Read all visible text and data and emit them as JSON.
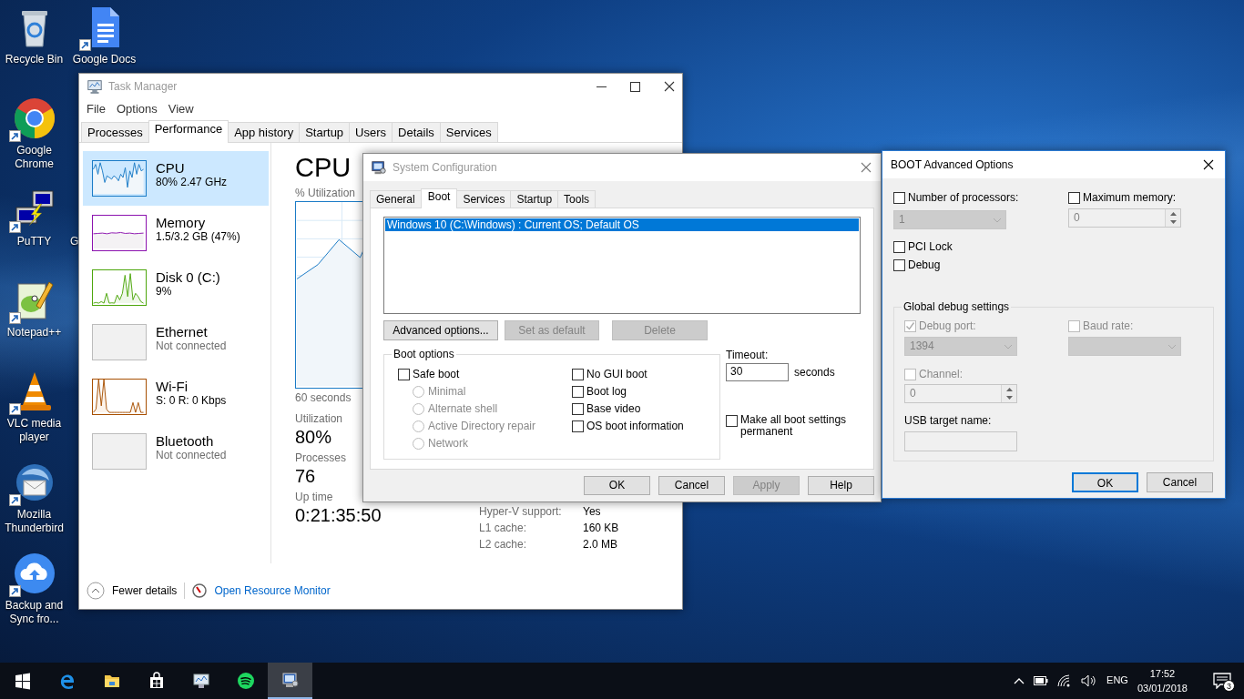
{
  "desktop_icons": [
    {
      "kind": "recycle",
      "label": "Recycle Bin",
      "shortcut": false
    },
    {
      "kind": "chrome",
      "label": "Google Chrome",
      "shortcut": true
    },
    {
      "kind": "putty",
      "label": "PuTTY",
      "shortcut": true
    },
    {
      "kind": "notepad",
      "label": "Notepad++",
      "shortcut": true
    },
    {
      "kind": "vlc",
      "label": "VLC media player",
      "shortcut": true
    },
    {
      "kind": "thunderbird",
      "label": "Mozilla Thunderbird",
      "shortcut": true
    },
    {
      "kind": "backup",
      "label": "Backup and Sync fro...",
      "shortcut": true
    }
  ],
  "desktop_icons_column_2": [
    {
      "kind": "docs",
      "label": "Google Docs",
      "shortcut": true
    },
    {
      "kind": "covered",
      "label": "G"
    }
  ],
  "task_manager": {
    "title": "Task Manager",
    "menu": [
      "File",
      "Options",
      "View"
    ],
    "tabs": [
      {
        "label": "Processes",
        "selected": false
      },
      {
        "label": "Performance",
        "selected": true
      },
      {
        "label": "App history",
        "selected": false
      },
      {
        "label": "Startup",
        "selected": false
      },
      {
        "label": "Users",
        "selected": false
      },
      {
        "label": "Details",
        "selected": false
      },
      {
        "label": "Services",
        "selected": false
      }
    ],
    "resources": [
      {
        "kind": "cpu",
        "name": "CPU",
        "detail": "80% 2.47 GHz",
        "connected": true,
        "selected": true,
        "color": "#1b7bc6"
      },
      {
        "kind": "memory",
        "name": "Memory",
        "detail": "1.5/3.2 GB (47%)",
        "connected": true,
        "selected": false,
        "color": "#8b12ae"
      },
      {
        "kind": "disk",
        "name": "Disk 0 (C:)",
        "detail": "9%",
        "connected": true,
        "selected": false,
        "color": "#4da60c"
      },
      {
        "kind": "idle",
        "name": "Ethernet",
        "detail": "Not connected",
        "connected": false,
        "selected": false
      },
      {
        "kind": "wifi",
        "name": "Wi-Fi",
        "detail": "S: 0 R: 0 Kbps",
        "connected": true,
        "selected": false,
        "color": "#a74f01"
      },
      {
        "kind": "idle",
        "name": "Bluetooth",
        "detail": "Not connected",
        "connected": false,
        "selected": false
      }
    ],
    "panel": {
      "title": "CPU",
      "graph_label": "% Utilization",
      "time_span": "60 seconds",
      "stats": [
        {
          "label": "Utilization",
          "value": "80%"
        },
        {
          "label": "Processes",
          "value": "76"
        },
        {
          "label": "Up time",
          "value": "0:21:35:50"
        }
      ],
      "specs": [
        {
          "label": "Hyper-V support:",
          "value": "Yes"
        },
        {
          "label": "L1 cache:",
          "value": "160 KB"
        },
        {
          "label": "L2 cache:",
          "value": "2.0 MB"
        }
      ]
    },
    "footer": {
      "fewer_details": "Fewer details",
      "resource_monitor": "Open Resource Monitor"
    }
  },
  "system_configuration": {
    "title": "System Configuration",
    "tabs": [
      {
        "label": "General",
        "selected": false
      },
      {
        "label": "Boot",
        "selected": true
      },
      {
        "label": "Services",
        "selected": false
      },
      {
        "label": "Startup",
        "selected": false
      },
      {
        "label": "Tools",
        "selected": false
      }
    ],
    "boot_entries": [
      {
        "label": "Windows 10 (C:\\Windows) : Current OS; Default OS",
        "selected": true
      }
    ],
    "entry_buttons": [
      {
        "label": "Advanced options...",
        "disabled": false
      },
      {
        "label": "Set as default",
        "disabled": true
      },
      {
        "label": "Delete",
        "disabled": true
      }
    ],
    "boot_options": {
      "title": "Boot options",
      "safe_boot": {
        "label": "Safe boot",
        "checked": false
      },
      "safe_boot_modes": [
        {
          "label": "Minimal",
          "selected": false,
          "disabled": true
        },
        {
          "label": "Alternate shell",
          "selected": false,
          "disabled": true
        },
        {
          "label": "Active Directory repair",
          "selected": false,
          "disabled": true
        },
        {
          "label": "Network",
          "selected": false,
          "disabled": true
        }
      ],
      "flags": [
        {
          "label": "No GUI boot",
          "checked": false
        },
        {
          "label": "Boot log",
          "checked": false
        },
        {
          "label": "Base video",
          "checked": false
        },
        {
          "label": "OS boot information",
          "checked": false
        }
      ]
    },
    "timeout": {
      "label": "Timeout:",
      "value": "30",
      "unit": "seconds"
    },
    "make_permanent": {
      "label": "Make all boot settings permanent",
      "checked": false
    },
    "buttons": [
      {
        "label": "OK",
        "disabled": false
      },
      {
        "label": "Cancel",
        "disabled": false
      },
      {
        "label": "Apply",
        "disabled": true
      },
      {
        "label": "Help",
        "disabled": false
      }
    ]
  },
  "boot_advanced": {
    "title": "BOOT Advanced Options",
    "number_of_processors": {
      "label": "Number of processors:",
      "checked": false,
      "value": "1"
    },
    "maximum_memory": {
      "label": "Maximum memory:",
      "checked": false,
      "value": "0"
    },
    "pci_lock": {
      "label": "PCI Lock",
      "checked": false
    },
    "debug": {
      "label": "Debug",
      "checked": false
    },
    "global_debug": {
      "title": "Global debug settings",
      "disabled": true,
      "debug_port": {
        "label": "Debug port:",
        "checked": true,
        "value": "1394"
      },
      "baud_rate": {
        "label": "Baud rate:",
        "checked": false
      },
      "channel": {
        "label": "Channel:",
        "checked": false,
        "value": "0"
      },
      "usb_target_name": {
        "label": "USB target name:"
      }
    },
    "buttons": [
      {
        "label": "OK",
        "default": true
      },
      {
        "label": "Cancel",
        "default": false
      }
    ]
  },
  "taskbar": {
    "apps": [
      {
        "kind": "start",
        "active": false
      },
      {
        "kind": "edge",
        "active": false
      },
      {
        "kind": "explorer",
        "active": false
      },
      {
        "kind": "store",
        "active": false
      },
      {
        "kind": "taskmgr",
        "active": false
      },
      {
        "kind": "spotify",
        "active": false
      },
      {
        "kind": "msconfig",
        "active": true
      }
    ],
    "tray": {
      "language": "ENG",
      "time": "17:52",
      "date": "03/01/2018",
      "notifications": "3"
    }
  }
}
